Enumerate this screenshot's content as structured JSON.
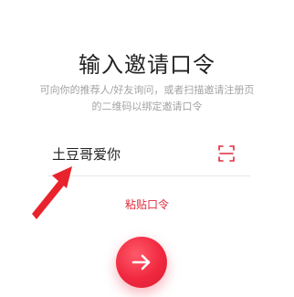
{
  "page": {
    "title": "输入邀请口令",
    "subtitle_line1": "可向你的推荐人/好友询问，或者扫描邀请注册页",
    "subtitle_line2": "的二维码以绑定邀请口令"
  },
  "invite_field": {
    "value": "土豆哥爱你",
    "scan_icon": "scan-frame-icon"
  },
  "paste_link": {
    "label": "粘贴口令"
  },
  "submit_button": {
    "icon": "arrow-right-icon"
  },
  "annotation": {
    "icon": "red-arrow-pointer"
  },
  "colors": {
    "accent": "#e02a3a",
    "text": "#222222",
    "hint": "#a3a3a3",
    "divider": "#e7e7e7"
  }
}
